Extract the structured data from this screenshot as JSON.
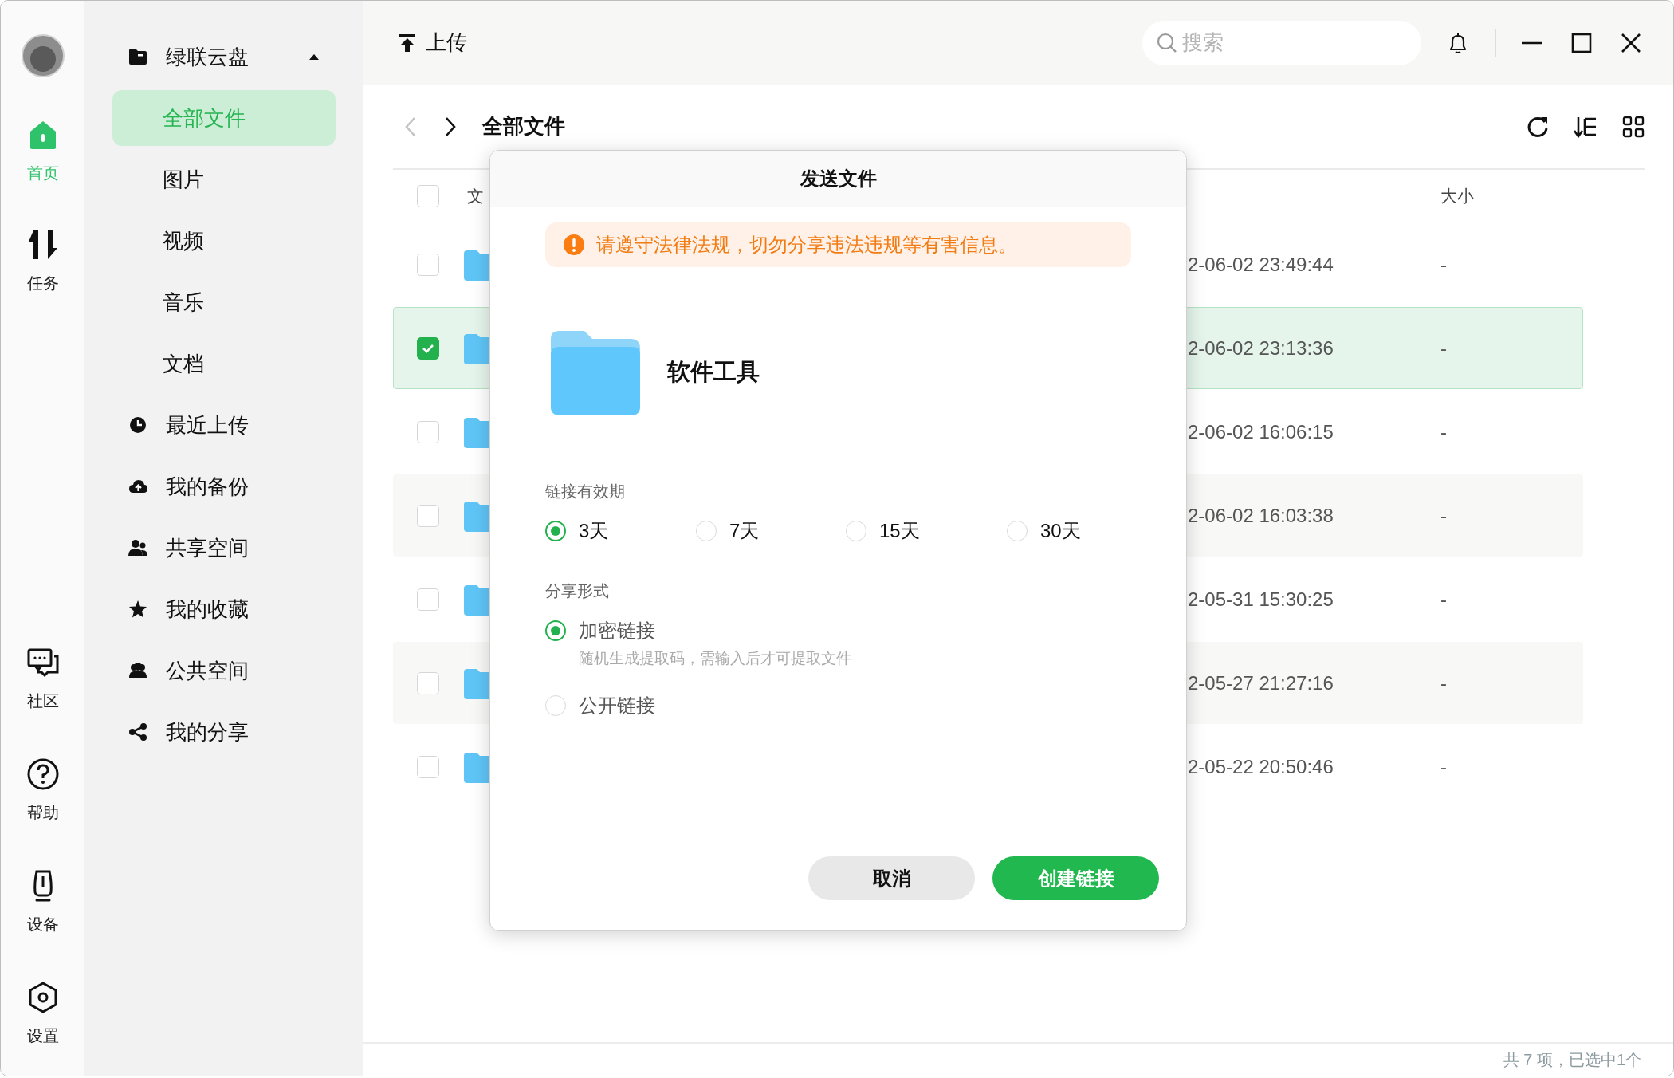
{
  "rail": {
    "top": [
      {
        "label": "首页",
        "selected": true
      },
      {
        "label": "任务",
        "selected": false
      }
    ],
    "bottom": [
      {
        "label": "社区",
        "selected": false
      },
      {
        "label": "帮助",
        "selected": false
      },
      {
        "label": "设备",
        "selected": false
      },
      {
        "label": "设置",
        "selected": false
      }
    ]
  },
  "sidebar": {
    "root": {
      "label": "绿联云盘",
      "expanded": true,
      "children": [
        {
          "label": "全部文件",
          "selected": true
        },
        {
          "label": "图片",
          "selected": false
        },
        {
          "label": "视频",
          "selected": false
        },
        {
          "label": "音乐",
          "selected": false
        },
        {
          "label": "文档",
          "selected": false
        }
      ]
    },
    "items": [
      {
        "label": "最近上传",
        "selected": false
      },
      {
        "label": "我的备份",
        "selected": false
      },
      {
        "label": "共享空间",
        "selected": false
      },
      {
        "label": "我的收藏",
        "selected": false
      },
      {
        "label": "公共空间",
        "selected": false
      },
      {
        "label": "我的分享",
        "selected": false
      }
    ]
  },
  "toolbar": {
    "upload": "上传",
    "search": {
      "placeholder": "搜索"
    }
  },
  "nav": {
    "back": {
      "disabled": true
    },
    "forward": {
      "disabled": false
    },
    "title": "全部文件"
  },
  "table": {
    "header": {
      "checked": false,
      "name": "文",
      "size": "大小"
    },
    "rows": [
      {
        "checked": false,
        "modified": "2-06-02 23:49:44",
        "size": "-"
      },
      {
        "checked": true,
        "modified": "2-06-02 23:13:36",
        "size": "-"
      },
      {
        "checked": false,
        "modified": "2-06-02 16:06:15",
        "size": "-"
      },
      {
        "checked": false,
        "modified": "2-06-02 16:03:38",
        "size": "-"
      },
      {
        "checked": false,
        "modified": "2-05-31 15:30:25",
        "size": "-"
      },
      {
        "checked": false,
        "modified": "2-05-27 21:27:16",
        "size": "-"
      },
      {
        "checked": false,
        "modified": "2-05-22 20:50:46",
        "size": "-"
      }
    ]
  },
  "dialog": {
    "title": "发送文件",
    "warning": "请遵守法律法规，切勿分享违法违规等有害信息。",
    "file": {
      "name": "软件工具"
    },
    "expiry": {
      "label": "链接有效期",
      "options": [
        {
          "label": "3天",
          "selected": true
        },
        {
          "label": "7天",
          "selected": false
        },
        {
          "label": "15天",
          "selected": false
        },
        {
          "label": "30天",
          "selected": false
        }
      ]
    },
    "share_type": {
      "label": "分享形式",
      "options": [
        {
          "label": "加密链接",
          "selected": true,
          "hint": "随机生成提取码，需输入后才可提取文件"
        },
        {
          "label": "公开链接",
          "selected": false
        }
      ]
    },
    "buttons": [
      {
        "label": "取消",
        "kind": "secondary"
      },
      {
        "label": "创建链接",
        "kind": "primary"
      }
    ]
  },
  "status_bar": "共 7 项，已选中1个"
}
